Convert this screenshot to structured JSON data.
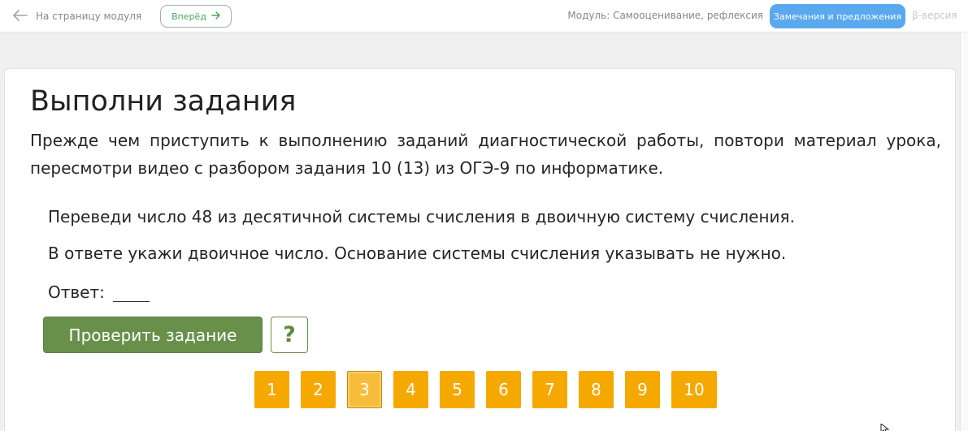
{
  "topbar": {
    "back_label": "На страницу модуля",
    "forward_label": "Вперёд",
    "module_label": "Модуль: Самооценивание, рефлексия",
    "feedback_label": "Замечания и предложения",
    "beta_label": "β-версия"
  },
  "main": {
    "title": "Выполни задания",
    "intro": "Прежде чем приступить к выполнению заданий диагностической работы, повтори материал урока, пересмотри видео с разбором задания 10 (13) из ОГЭ-9 по информатике.",
    "task_line1": "Переведи число 48 из десятичной системы счисления в двоичную систему счисления.",
    "task_line2": "В ответе укажи двоичное число. Основание системы счисления указывать не нужно.",
    "answer_label": "Ответ:",
    "answer_value": "",
    "check_button": "Проверить задание",
    "help_button": "?"
  },
  "pagination": {
    "pages": [
      "1",
      "2",
      "3",
      "4",
      "5",
      "6",
      "7",
      "8",
      "9",
      "10"
    ],
    "active": "3"
  },
  "colors": {
    "accent_blue": "#5aa9ee",
    "check_green": "#69904a",
    "page_orange": "#f5a800",
    "page_active": "#f7bc3a",
    "forward_green": "#4aa35e"
  },
  "icons": {
    "back": "arrow-left-icon",
    "forward": "arrow-right-icon",
    "cursor": "mouse-cursor-icon"
  }
}
